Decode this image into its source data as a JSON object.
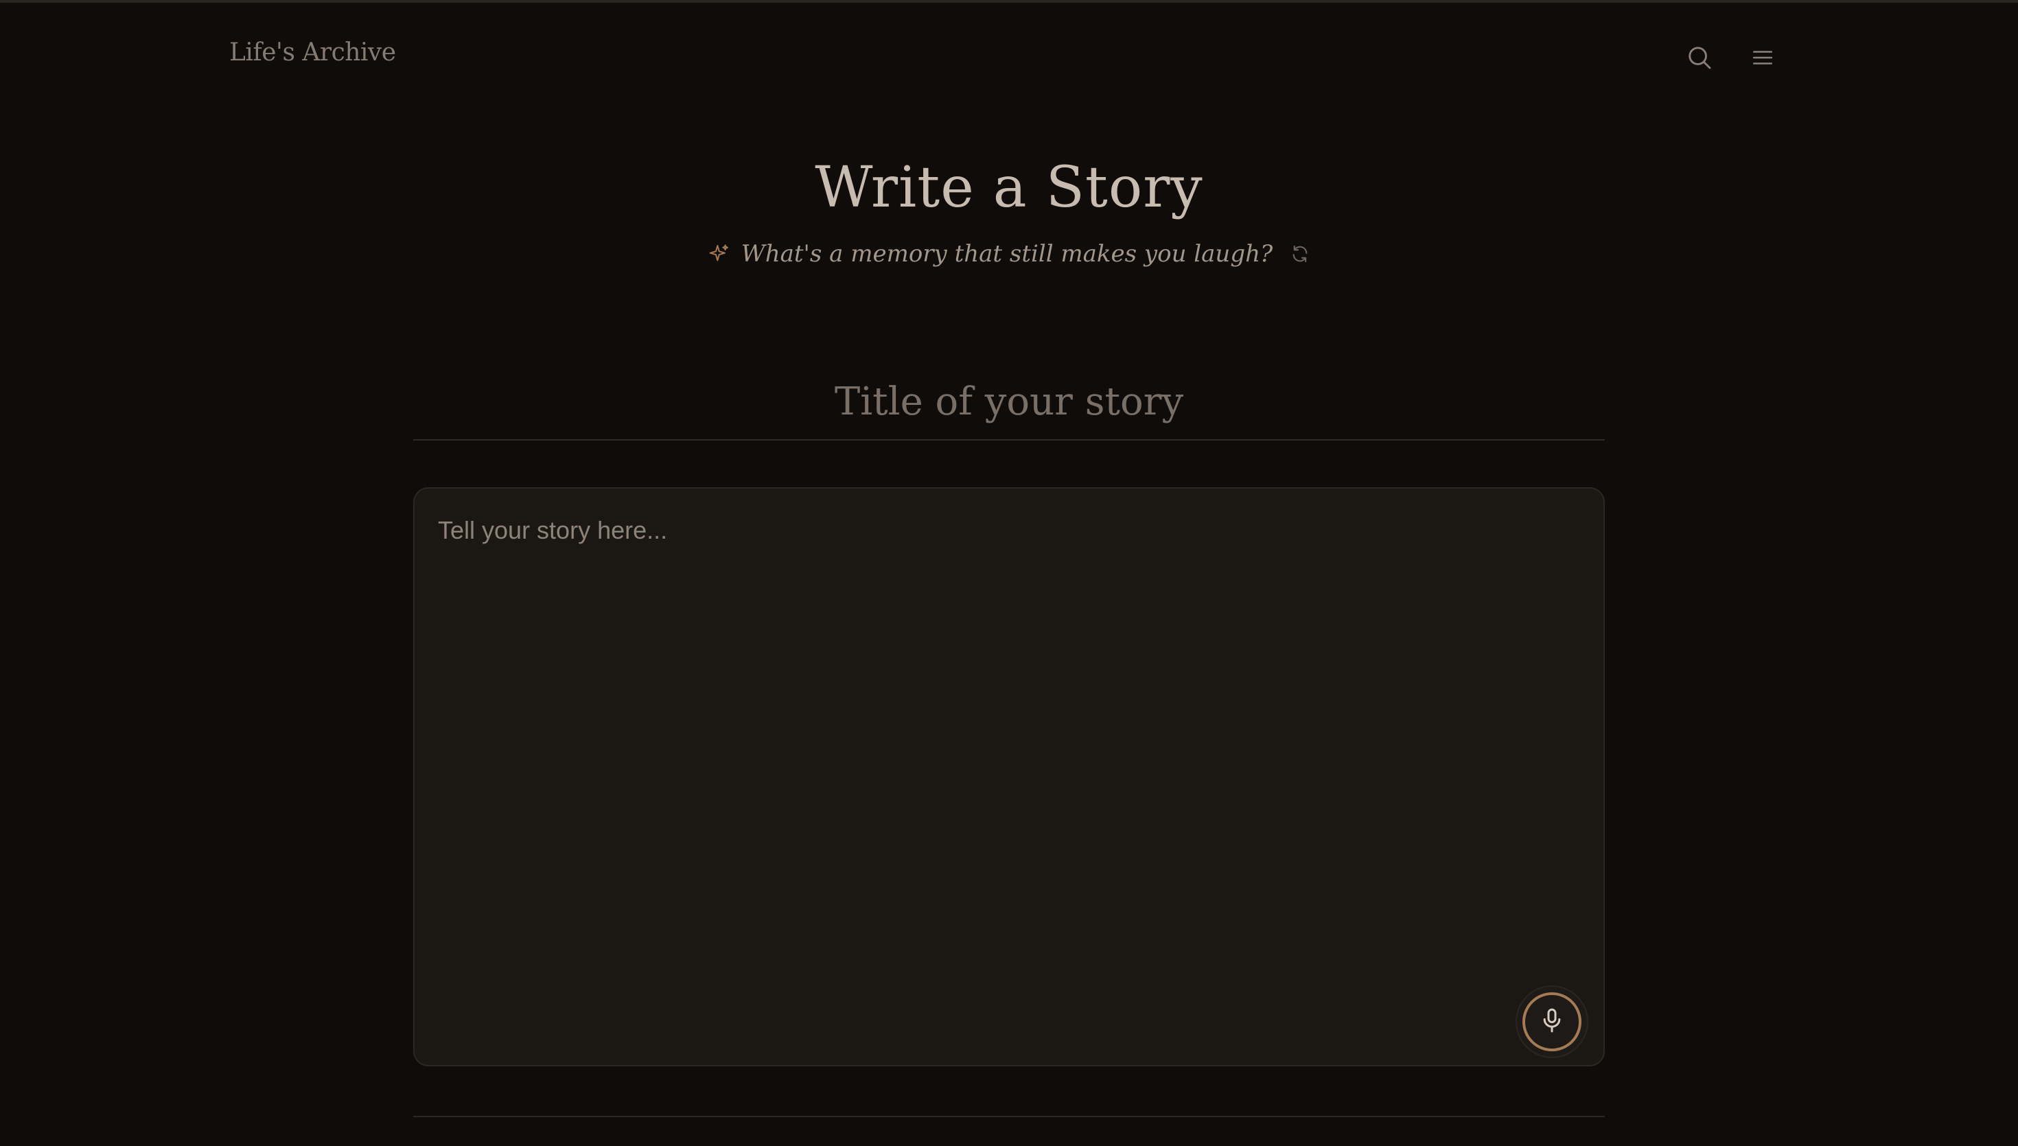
{
  "header": {
    "brand": "Life's Archive",
    "icons": [
      "search-icon",
      "menu-icon"
    ]
  },
  "page": {
    "title": "Write a Story",
    "prompt": "What's a memory that still makes you laugh?",
    "prompt_icons": [
      "sparkle-icon",
      "refresh-icon"
    ]
  },
  "form": {
    "title_placeholder": "Title of your story",
    "title_value": "",
    "body_placeholder": "Tell your story here...",
    "body_value": "",
    "mic_icon": "microphone-icon"
  },
  "colors": {
    "background": "#0f0c0a",
    "surface": "#1b1814",
    "accent": "#a57b55",
    "text": "#c8bcb0",
    "muted": "#857b72"
  }
}
